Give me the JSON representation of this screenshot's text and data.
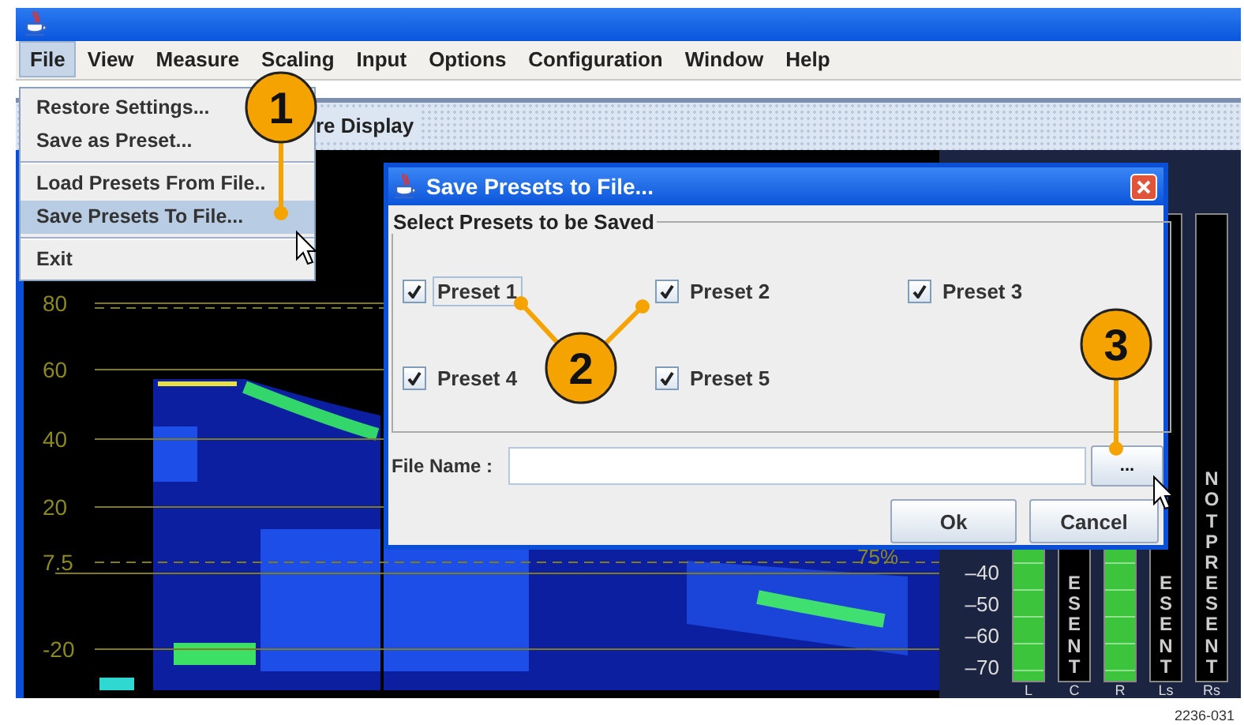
{
  "menubar": [
    {
      "label": "File",
      "selected": true
    },
    {
      "label": "View",
      "selected": false
    },
    {
      "label": "Measure",
      "selected": false
    },
    {
      "label": "Scaling",
      "selected": false
    },
    {
      "label": "Input",
      "selected": false
    },
    {
      "label": "Options",
      "selected": false
    },
    {
      "label": "Configuration",
      "selected": false
    },
    {
      "label": "Window",
      "selected": false
    },
    {
      "label": "Help",
      "selected": false
    }
  ],
  "file_menu": [
    {
      "kind": "item",
      "label": "Restore Settings...",
      "selected": false
    },
    {
      "kind": "item",
      "label": "Save as Preset...",
      "selected": false
    },
    {
      "kind": "separator"
    },
    {
      "kind": "item",
      "label": "Load Presets From File..",
      "selected": false
    },
    {
      "kind": "item",
      "label": "Save Presets To File...",
      "selected": true
    },
    {
      "kind": "separator"
    },
    {
      "kind": "item",
      "label": "Exit",
      "selected": false
    }
  ],
  "display_tab": {
    "label": "re Display"
  },
  "waveform": {
    "graticule_labels": [
      "80",
      "60",
      "40",
      "20",
      "7.5",
      "-20"
    ],
    "percent_label": "75%"
  },
  "audio_meters": {
    "scale": [
      "–40",
      "–50",
      "–60",
      "–70"
    ],
    "bars": [
      {
        "label": "L",
        "kind": "signal"
      },
      {
        "label": "C",
        "kind": "absent",
        "text": "ESENT"
      },
      {
        "label": "R",
        "kind": "signal"
      },
      {
        "label": "Ls",
        "kind": "absent",
        "text": "ESENT"
      },
      {
        "label": "Rs",
        "kind": "absent_full",
        "text": "NOT PRESENT"
      }
    ]
  },
  "dialog": {
    "title": "Save Presets to File...",
    "group_title": "Select Presets to be Saved",
    "presets": [
      {
        "label": "Preset 1",
        "checked": true,
        "focused": true
      },
      {
        "label": "Preset 2",
        "checked": true,
        "focused": false
      },
      {
        "label": "Preset 3",
        "checked": true,
        "focused": false
      },
      {
        "label": "Preset 4",
        "checked": true,
        "focused": false
      },
      {
        "label": "Preset 5",
        "checked": true,
        "focused": false
      }
    ],
    "file_name_label": "File Name :",
    "browse_button": "...",
    "buttons": [
      "Ok",
      "Cancel"
    ]
  },
  "callouts": [
    "1",
    "2",
    "3"
  ],
  "figure_id": "2236-031"
}
